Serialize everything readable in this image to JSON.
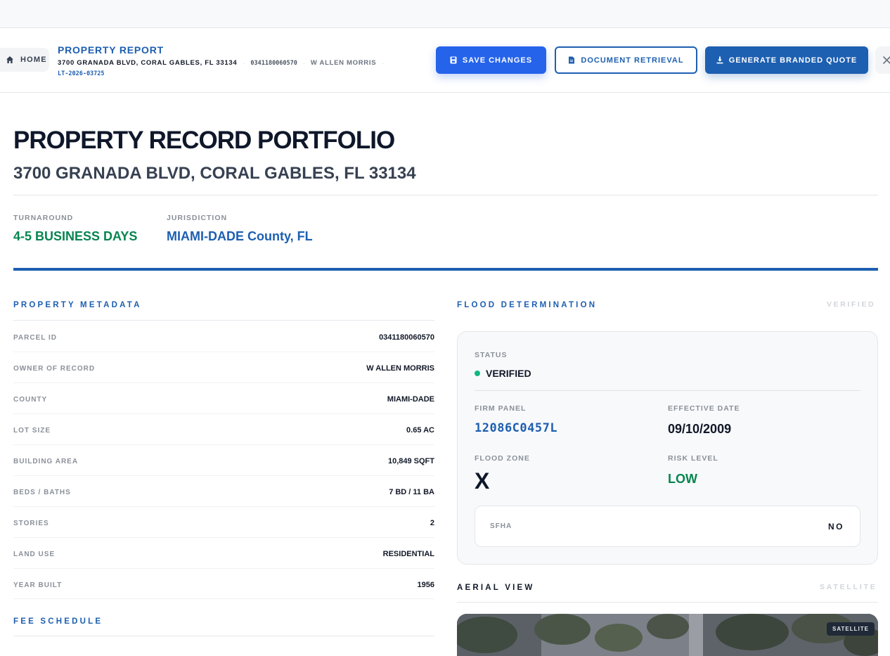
{
  "header": {
    "home_label": "HOME",
    "report_title": "PROPERTY REPORT",
    "address": "3700 GRANADA BLVD, CORAL GABLES, FL 33134",
    "separator": "·",
    "parcel_id": "0341180060570",
    "owner": "W ALLEN MORRIS",
    "reference": "LT-2026-03725",
    "buttons": {
      "save": "SAVE CHANGES",
      "document": "DOCUMENT RETRIEVAL",
      "quote": "GENERATE BRANDED QUOTE"
    }
  },
  "hero": {
    "title": "PROPERTY RECORD PORTFOLIO",
    "subtitle": "3700 GRANADA BLVD, CORAL GABLES, FL 33134",
    "turnaround_label": "TURNAROUND",
    "turnaround_value": "4-5 BUSINESS DAYS",
    "jurisdiction_label": "JURISDICTION",
    "jurisdiction_value": "MIAMI-DADE County, FL"
  },
  "metadata": {
    "title": "PROPERTY METADATA",
    "rows": [
      {
        "label": "PARCEL ID",
        "value": "0341180060570"
      },
      {
        "label": "OWNER OF RECORD",
        "value": "W ALLEN MORRIS"
      },
      {
        "label": "COUNTY",
        "value": "MIAMI-DADE"
      },
      {
        "label": "LOT SIZE",
        "value": "0.65 AC"
      },
      {
        "label": "BUILDING AREA",
        "value": "10,849 SQFT"
      },
      {
        "label": "BEDS / BATHS",
        "value": "7 BD / 11 BA"
      },
      {
        "label": "STORIES",
        "value": "2"
      },
      {
        "label": "LAND USE",
        "value": "RESIDENTIAL"
      },
      {
        "label": "YEAR BUILT",
        "value": "1956"
      }
    ]
  },
  "fee_schedule": {
    "title": "FEE SCHEDULE"
  },
  "flood": {
    "title": "FLOOD DETERMINATION",
    "tag": "VERIFIED",
    "status_label": "STATUS",
    "status_value": "VERIFIED",
    "firm_label": "FIRM PANEL",
    "firm_value": "12086C0457L",
    "effective_label": "EFFECTIVE DATE",
    "effective_value": "09/10/2009",
    "zone_label": "FLOOD ZONE",
    "zone_value": "X",
    "risk_label": "RISK LEVEL",
    "risk_value": "LOW",
    "sfha_label": "SFHA",
    "sfha_value": "NO"
  },
  "aerial": {
    "title": "AERIAL VIEW",
    "tag": "SATELLITE",
    "badge": "SATELLITE"
  },
  "colors": {
    "accent_blue": "#1d5fb1",
    "save_blue": "#2563eb",
    "success_green": "#07854f",
    "status_dot": "#10b981"
  },
  "icons": {
    "home": "home-icon",
    "save": "floppy-disk-icon",
    "document": "document-icon",
    "download": "download-icon",
    "close": "close-icon",
    "status": "status-dot-icon"
  }
}
